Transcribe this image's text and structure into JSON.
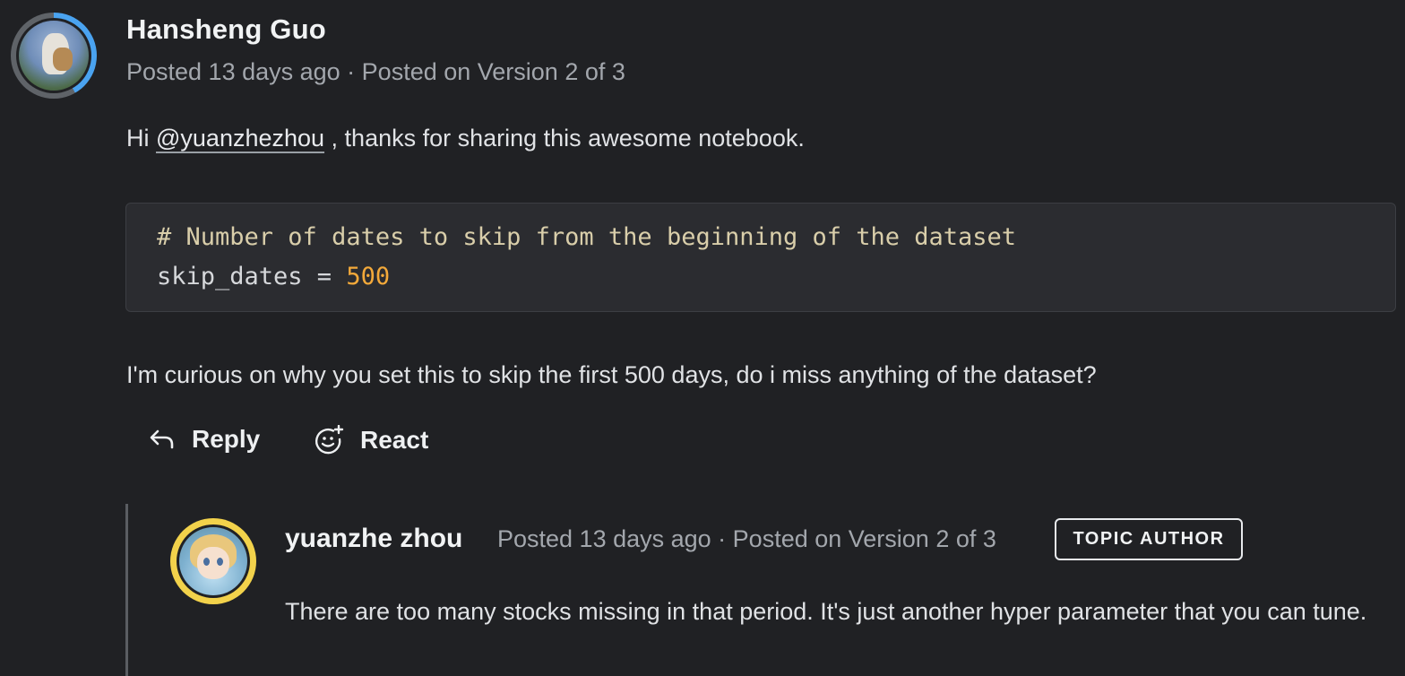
{
  "post": {
    "author": "Hansheng Guo",
    "meta": "Posted 13 days ago · Posted on Version 2 of 3",
    "greeting_prefix": "Hi ",
    "mention": "@yuanzhezhou",
    "greeting_suffix": " , thanks for sharing this awesome notebook.",
    "code": {
      "comment": "# Number of dates to skip from the beginning of the dataset",
      "var_prefix": "skip_dates = ",
      "value": "500"
    },
    "question": "I'm curious on why you set this to skip the first 500 days, do i miss anything of the dataset?"
  },
  "actions": {
    "reply_label": "Reply",
    "react_label": "React",
    "reply_icon": "reply-arrow-icon",
    "react_icon": "add-emoji-icon"
  },
  "reply": {
    "author": "yuanzhe zhou",
    "meta": "Posted 13 days ago · Posted on Version 2 of 3",
    "badge": "TOPIC AUTHOR",
    "text": "There are too many stocks missing in that period. It's just another hyper parameter that you can tune."
  },
  "colors": {
    "background": "#202124",
    "code_background": "#2b2c30",
    "code_comment": "#d9ceaa",
    "code_number": "#f3a93a",
    "avatar_ring_progress": "#4aa3f0",
    "reply_avatar_ring": "#f2d24b"
  }
}
